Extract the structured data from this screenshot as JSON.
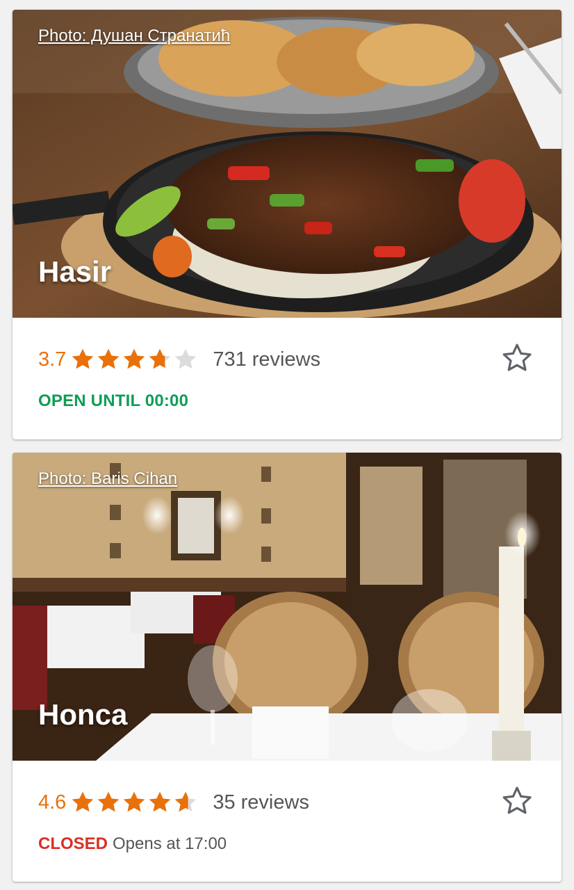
{
  "restaurants": [
    {
      "name": "Hasir",
      "photo_credit": "Photo: Душан Странатић",
      "rating": "3.7",
      "stars": 3.7,
      "reviews": "731 reviews",
      "status": "OPEN UNTIL 00:00",
      "status_detail": ""
    },
    {
      "name": "Honca",
      "photo_credit": "Photo: Baris Cihan",
      "rating": "4.6",
      "stars": 4.6,
      "reviews": "35 reviews",
      "status": "CLOSED",
      "status_detail": "Opens at 17:00"
    }
  ],
  "colors": {
    "star_filled": "#e8710a",
    "star_empty": "#dcdcdc",
    "open": "#0f9d58",
    "closed": "#d93025"
  },
  "icons": {
    "rating_star": "star-icon",
    "favorite": "star-outline-icon"
  }
}
